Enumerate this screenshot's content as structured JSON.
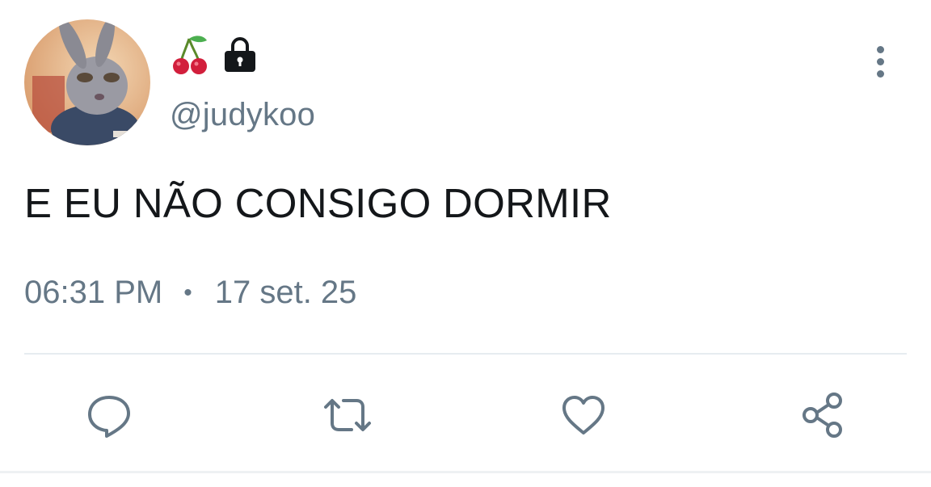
{
  "user": {
    "name_icons": [
      "cherries-icon",
      "lock-icon"
    ],
    "handle": "@judykoo"
  },
  "tweet": {
    "text": "E EU NÃO CONSIGO DORMIR",
    "time": "06:31 PM",
    "separator": "•",
    "date": "17 set. 25"
  },
  "actions": [
    "reply-icon",
    "retweet-icon",
    "like-icon",
    "share-icon"
  ],
  "colors": {
    "text": "#14171a",
    "secondary": "#657786",
    "divider": "#e6ecf0",
    "cherry": "#d21f3c"
  }
}
